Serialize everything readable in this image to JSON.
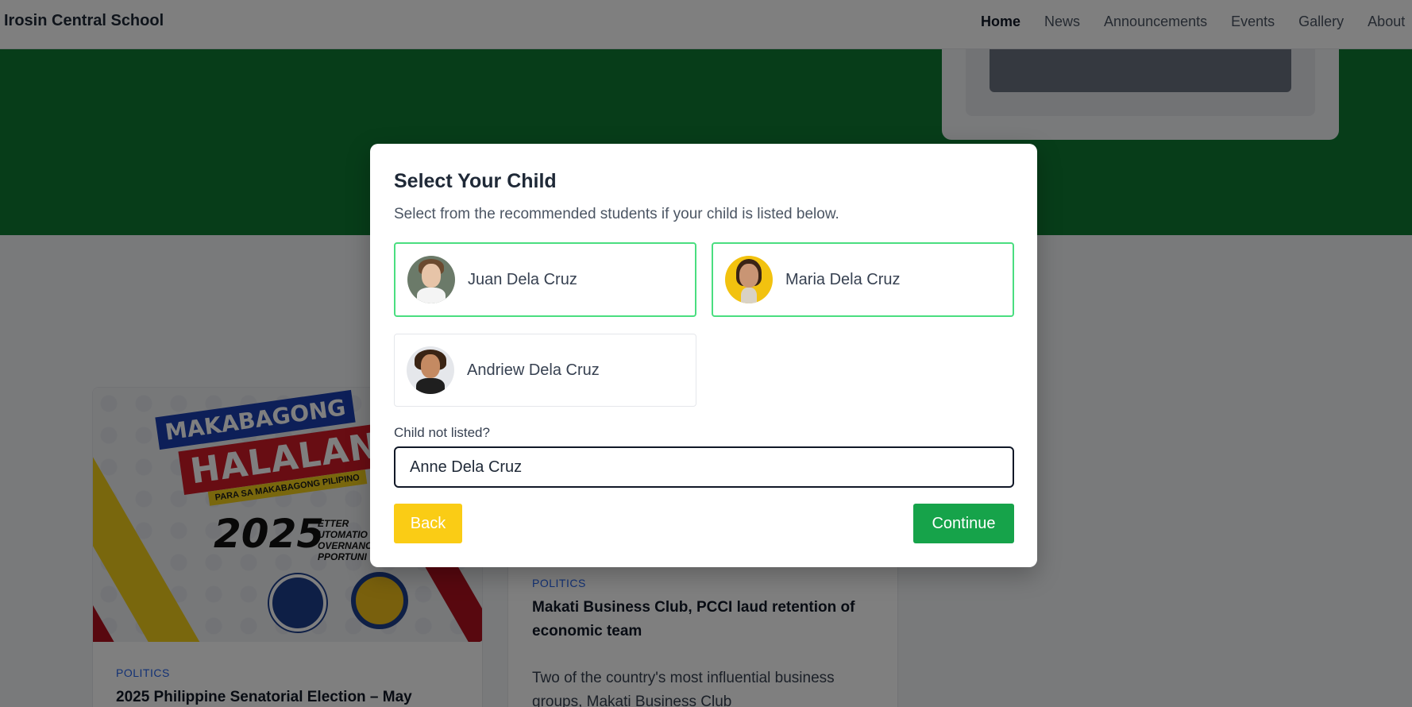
{
  "header": {
    "brand": "Irosin Central School",
    "nav": [
      "Home",
      "News",
      "Announcements",
      "Events",
      "Gallery",
      "About"
    ],
    "active_nav": "Home"
  },
  "articles": [
    {
      "category": "POLITICS",
      "title": "2025 Philippine Senatorial Election – May",
      "poster": {
        "line1": "MAKABAGONG",
        "line2": "HALALAN",
        "tagline": "PARA SA MAKABAGONG PILIPINO",
        "year": "2025",
        "side_text": "ETTER\nUTOMATIO\nOVERNANC\nPPORTUNI"
      }
    },
    {
      "category": "POLITICS",
      "title": "Makati Business Club, PCCI laud retention of economic team",
      "excerpt": "Two of the country's most influential business groups, Makati Business Club"
    }
  ],
  "modal": {
    "title": "Select Your Child",
    "subtitle": "Select from the recommended students if your child is listed below.",
    "children": [
      {
        "name": "Juan Dela Cruz",
        "selected": true
      },
      {
        "name": "Maria Dela Cruz",
        "selected": true
      },
      {
        "name": "Andriew Dela Cruz",
        "selected": false
      }
    ],
    "not_listed_label": "Child not listed?",
    "not_listed_value": "Anne Dela Cruz",
    "back_label": "Back",
    "continue_label": "Continue"
  },
  "colors": {
    "hero_green": "#0e7a33",
    "selected_border": "#4ade80",
    "back_button": "#facc15",
    "continue_button": "#16a34a",
    "category_blue": "#2563eb"
  }
}
